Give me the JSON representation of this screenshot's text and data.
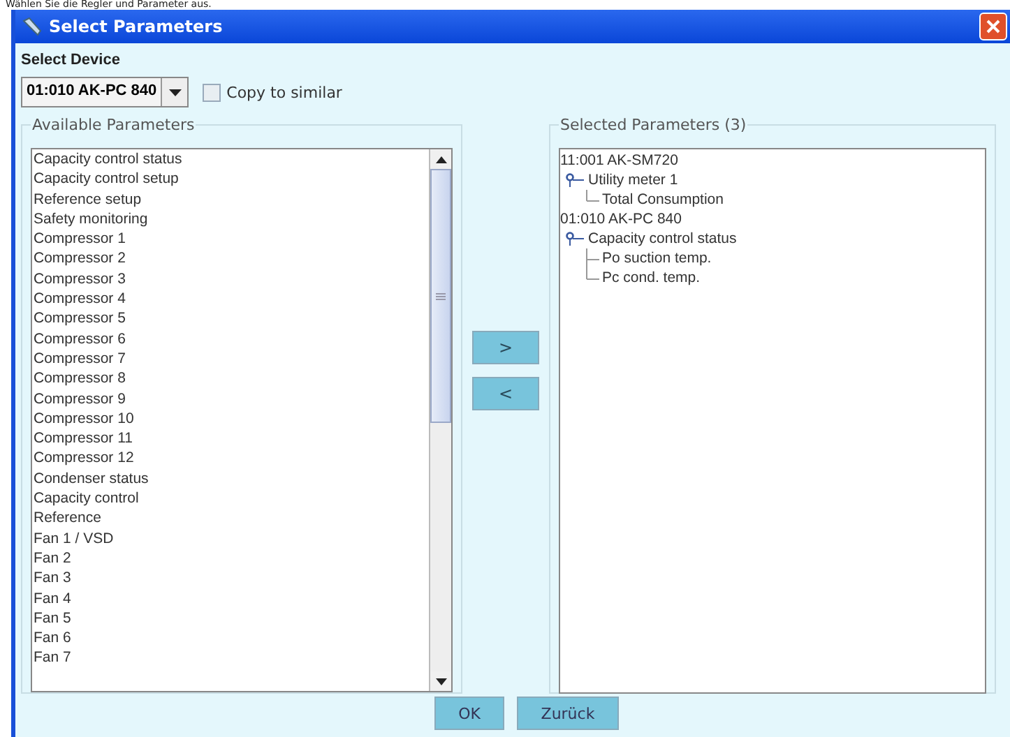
{
  "page_heading": "Wählen Sie die Regler und Parameter aus.",
  "window": {
    "title": "Select Parameters"
  },
  "device": {
    "label": "Select Device",
    "value": "01:010 AK-PC 840"
  },
  "copy_to_similar": {
    "label": "Copy to similar",
    "checked": false
  },
  "available": {
    "title": "Available Parameters",
    "items": [
      "Capacity control status",
      "Capacity control setup",
      "Reference setup",
      "Safety monitoring",
      "Compressor 1",
      "Compressor 2",
      "Compressor 3",
      "Compressor 4",
      "Compressor 5",
      "Compressor 6",
      "Compressor 7",
      "Compressor 8",
      "Compressor 9",
      "Compressor 10",
      "Compressor 11",
      "Compressor 12",
      "Condenser status",
      "Capacity control",
      "Reference",
      "Fan 1 / VSD",
      "Fan 2",
      "Fan 3",
      "Fan 4",
      "Fan 5",
      "Fan 6",
      "Fan 7"
    ]
  },
  "move_buttons": [
    ">",
    "<"
  ],
  "selected": {
    "title": "Selected Parameters (3)",
    "tree": [
      {
        "label": "11:001 AK-SM720",
        "children": [
          {
            "label": "Utility meter 1",
            "expanded": true,
            "children": [
              {
                "label": "Total Consumption"
              }
            ]
          }
        ]
      },
      {
        "label": "01:010 AK-PC 840",
        "children": [
          {
            "label": "Capacity control status",
            "expanded": true,
            "children": [
              {
                "label": "Po suction temp."
              },
              {
                "label": "Pc cond. temp."
              }
            ]
          }
        ]
      }
    ]
  },
  "buttons": [
    "OK",
    "Zurück"
  ]
}
